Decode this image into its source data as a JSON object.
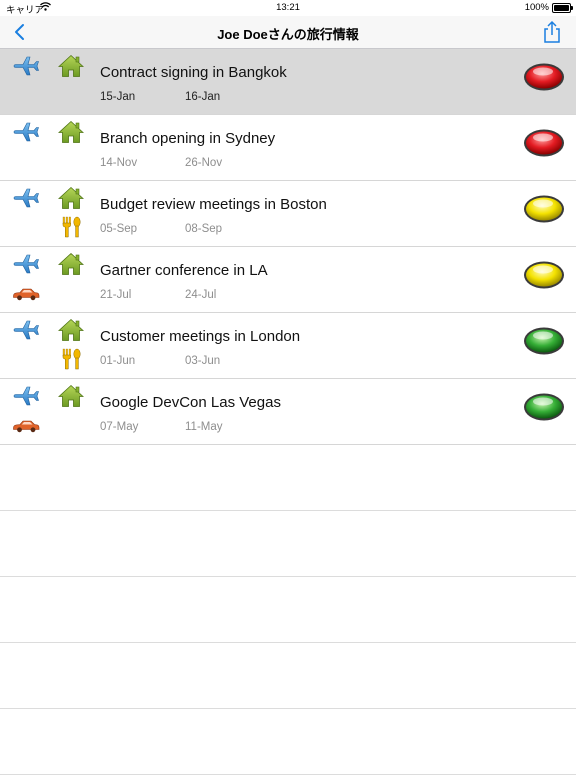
{
  "status_bar": {
    "carrier": "キャリア",
    "time": "13:21",
    "battery": "100%"
  },
  "nav": {
    "title": "Joe Doeさんの旅行情報"
  },
  "colors": {
    "accent": "#1a7fe0",
    "red": "#d8131b",
    "yellow": "#f2e100",
    "green": "#2ea83a"
  },
  "trips": [
    {
      "name": "Contract signing in Bangkok",
      "start": "15-Jan",
      "end": "16-Jan",
      "status": "red",
      "extra": "none",
      "selected": true
    },
    {
      "name": "Branch opening in Sydney",
      "start": "14-Nov",
      "end": "26-Nov",
      "status": "red",
      "extra": "none",
      "selected": false
    },
    {
      "name": "Budget review meetings in Boston",
      "start": "05-Sep",
      "end": "08-Sep",
      "status": "yellow",
      "extra": "dining",
      "selected": false
    },
    {
      "name": "Gartner conference in LA",
      "start": "21-Jul",
      "end": "24-Jul",
      "status": "yellow",
      "extra": "car",
      "selected": false
    },
    {
      "name": "Customer meetings in London",
      "start": "01-Jun",
      "end": "03-Jun",
      "status": "green",
      "extra": "dining",
      "selected": false
    },
    {
      "name": "Google DevCon Las Vegas",
      "start": "07-May",
      "end": "11-May",
      "status": "green",
      "extra": "car",
      "selected": false
    }
  ]
}
